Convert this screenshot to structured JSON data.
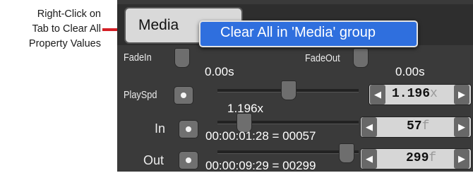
{
  "annotation": {
    "line1": "Right-Click on",
    "line2": "Tab to Clear All",
    "line3": "Property Values"
  },
  "tab": {
    "label": "Media"
  },
  "context_menu": {
    "item": "Clear All in 'Media' group"
  },
  "fade_in": {
    "label": "FadeIn",
    "value": "0.00s"
  },
  "fade_out": {
    "label": "FadeOut",
    "value": "0.00s"
  },
  "play_speed": {
    "label": "PlaySpd",
    "value": "1.196x",
    "stepper_value": "1.196",
    "stepper_unit": "x"
  },
  "in_point": {
    "label": "In",
    "timecode": "00:00:01:28 = 00057",
    "stepper_value": "57",
    "stepper_unit": "f"
  },
  "out_point": {
    "label": "Out",
    "timecode": "00:00:09:29 = 00299",
    "stepper_value": "299",
    "stepper_unit": "f"
  },
  "icons": {
    "left": "◀",
    "right": "▶"
  },
  "colors": {
    "menu_highlight": "#2f6fde",
    "annotation_line": "#d41f26",
    "panel": "#3a3a3a"
  }
}
